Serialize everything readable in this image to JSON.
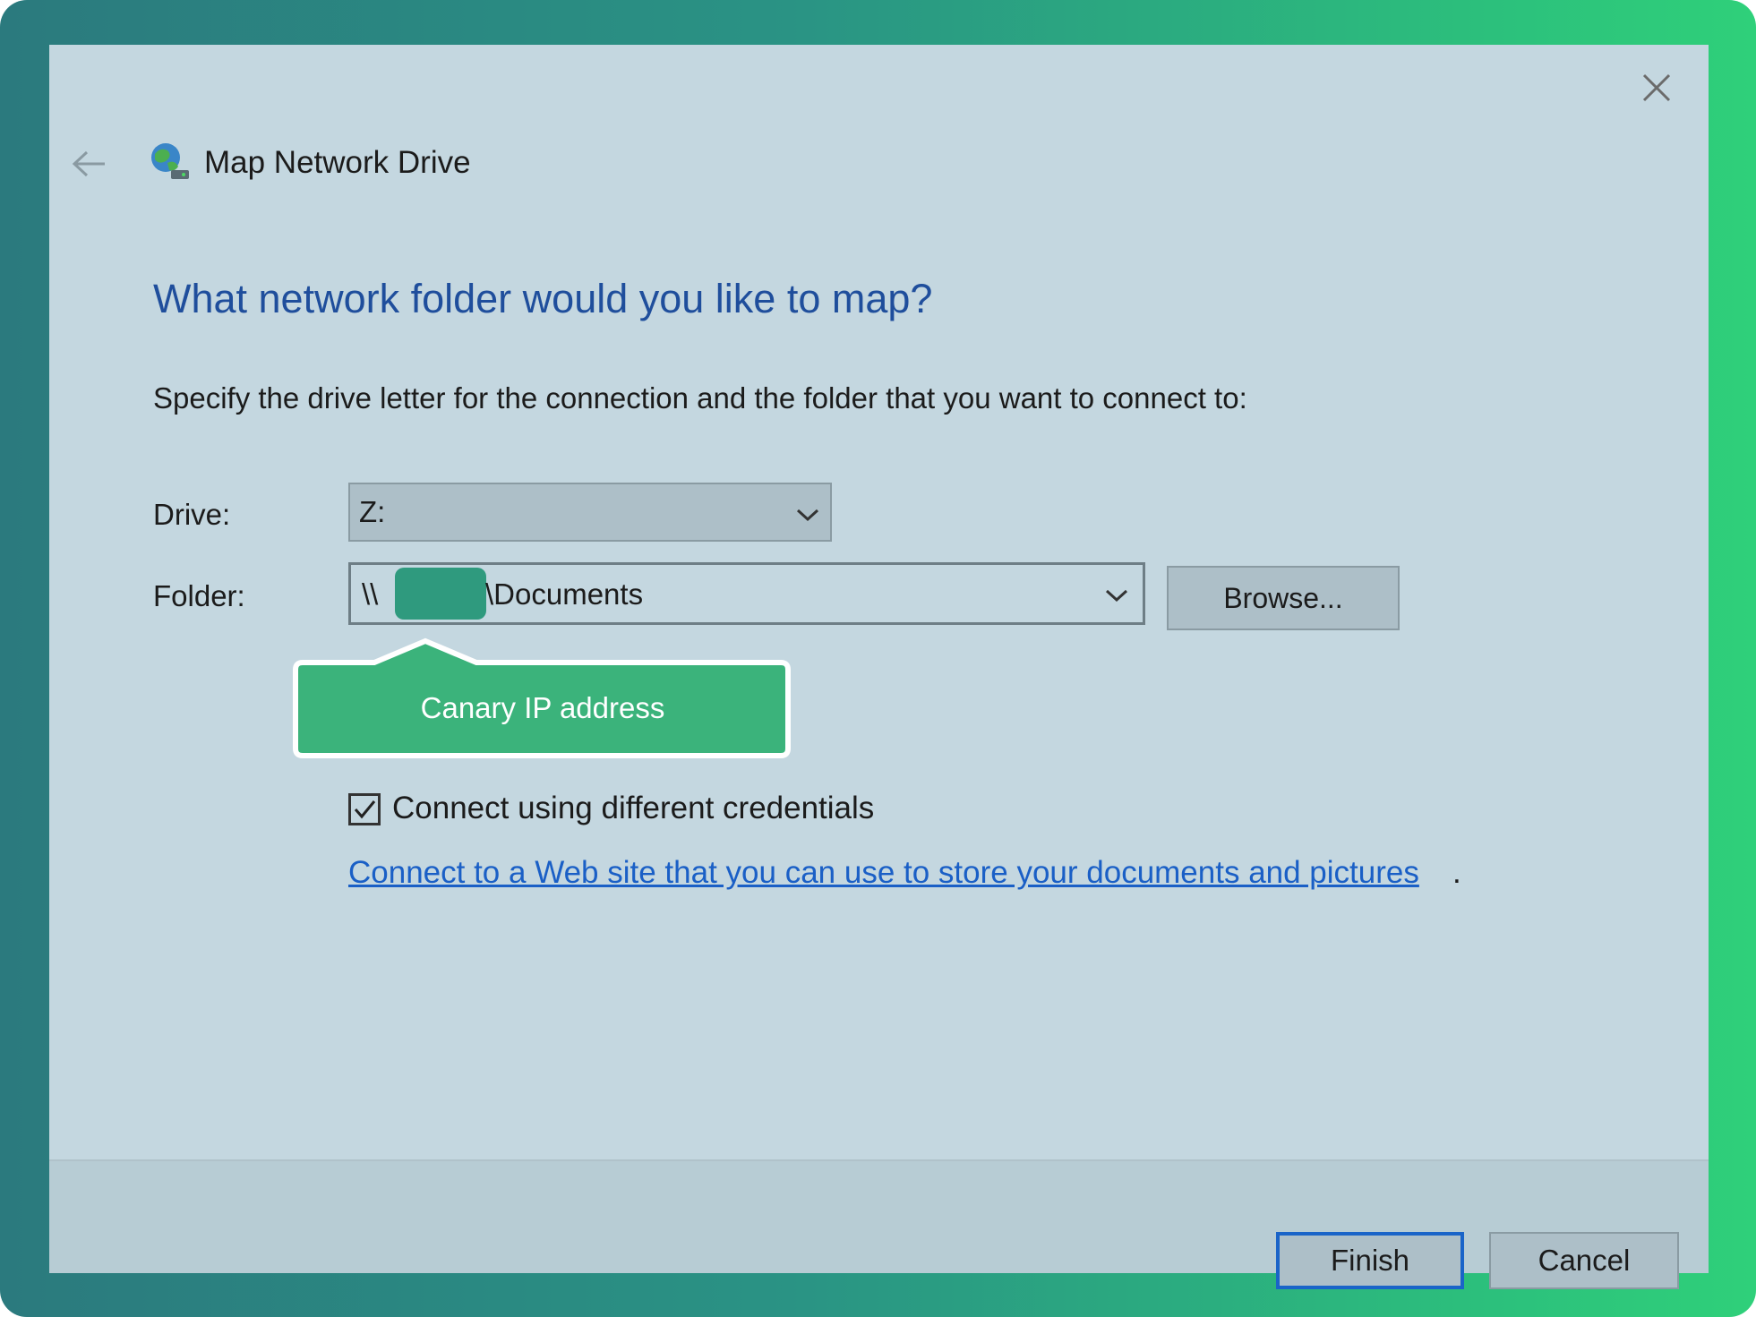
{
  "window": {
    "title": "Map Network Drive",
    "heading": "What network folder would you like to map?",
    "instructions": "Specify the drive letter for the connection and the folder that you want to connect to:"
  },
  "form": {
    "drive_label": "Drive:",
    "drive_value": "Z:",
    "folder_label": "Folder:",
    "folder_prefix": "\\\\",
    "folder_suffix": "\\Documents",
    "browse_label": "Browse..."
  },
  "tooltip": {
    "text": "Canary IP address"
  },
  "options": {
    "credentials_label": "Connect using different credentials",
    "credentials_checked": true,
    "web_link": "Connect to a Web site that you can use to store your documents and pictures",
    "web_link_suffix": "."
  },
  "footer": {
    "finish_label": "Finish",
    "cancel_label": "Cancel"
  },
  "icons": {
    "back": "back-arrow-icon",
    "close": "close-icon",
    "app": "network-drive-icon",
    "dropdown": "chevron-down-icon",
    "check": "checkmark-icon"
  },
  "colors": {
    "heading": "#1f4e9c",
    "link": "#1a5fc6",
    "accent_border": "#1a64c8",
    "tooltip": "#3bb37b",
    "dialog_bg": "#c4d7e0"
  }
}
